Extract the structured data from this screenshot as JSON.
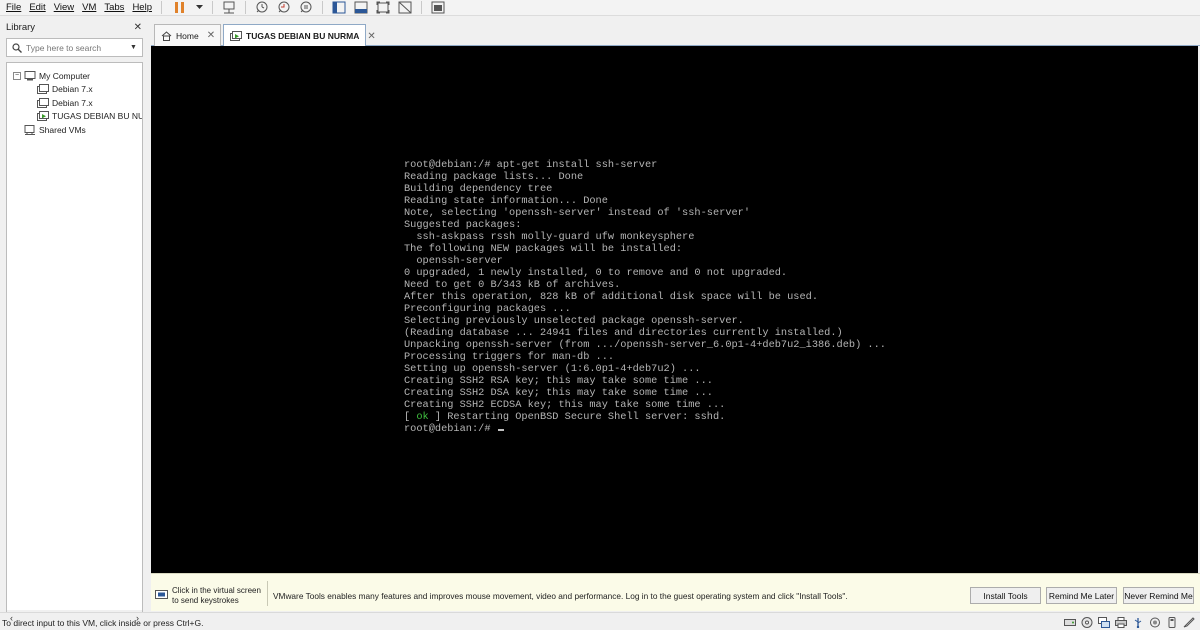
{
  "menu": [
    "File",
    "Edit",
    "View",
    "VM",
    "Tabs",
    "Help"
  ],
  "library": {
    "title": "Library",
    "close": "✕",
    "search_placeholder": "Type here to search",
    "tree": [
      {
        "label": "My Computer",
        "expander": "−"
      },
      {
        "label": "Debian 7.x"
      },
      {
        "label": "Debian 7.x"
      },
      {
        "label": "TUGAS DEBIAN BU NURMA"
      },
      {
        "label": "Shared VMs"
      }
    ],
    "scroll_left": "‹",
    "scroll_right": "›"
  },
  "tabs": [
    {
      "label": "Home",
      "close": "✕"
    },
    {
      "label": "TUGAS DEBIAN BU NURMA",
      "close": "✕"
    }
  ],
  "terminal": {
    "lines": [
      "root@debian:/# apt-get install ssh-server",
      "Reading package lists... Done",
      "Building dependency tree",
      "Reading state information... Done",
      "Note, selecting 'openssh-server' instead of 'ssh-server'",
      "Suggested packages:",
      "  ssh-askpass rssh molly-guard ufw monkeysphere",
      "The following NEW packages will be installed:",
      "  openssh-server",
      "0 upgraded, 1 newly installed, 0 to remove and 0 not upgraded.",
      "Need to get 0 B/343 kB of archives.",
      "After this operation, 828 kB of additional disk space will be used.",
      "Preconfiguring packages ...",
      "Selecting previously unselected package openssh-server.",
      "(Reading database ... 24941 files and directories currently installed.)",
      "Unpacking openssh-server (from .../openssh-server_6.0p1-4+deb7u2_i386.deb) ...",
      "Processing triggers for man-db ...",
      "Setting up openssh-server (1:6.0p1-4+deb7u2) ...",
      "Creating SSH2 RSA key; this may take some time ...",
      "Creating SSH2 DSA key; this may take some time ...",
      "Creating SSH2 ECDSA key; this may take some time ..."
    ],
    "ok_prefix": "[ ",
    "ok_word": "ok",
    "ok_suffix": " ] Restarting OpenBSD Secure Shell server: sshd.",
    "prompt": "root@debian:/# ",
    "ok_color": "#3fbf3f",
    "text_color": "#b5b5b5"
  },
  "notification": {
    "hint_line1": "Click in the virtual screen",
    "hint_line2": "to send keystrokes",
    "message": "VMware Tools enables many features and improves mouse movement, video and performance. Log in to the guest operating system and click \"Install Tools\".",
    "install_button": "Install Tools",
    "remind_later_button": "Remind Me Later",
    "never_remind_button": "Never Remind Me"
  },
  "status": {
    "text": "To direct input to this VM, click inside or press Ctrl+G.",
    "icons": [
      "hard-disk-icon",
      "cd-dvd-icon",
      "network-adapter-icon",
      "printer-icon",
      "usb-icon",
      "sound-icon",
      "removable-device-icon",
      "message-icon"
    ]
  },
  "colors": {
    "console_bg": "#000000",
    "notification_bg": "#fbfbe8",
    "pause_orange": "#e0822b",
    "tab_border": "#8fa9c6"
  }
}
